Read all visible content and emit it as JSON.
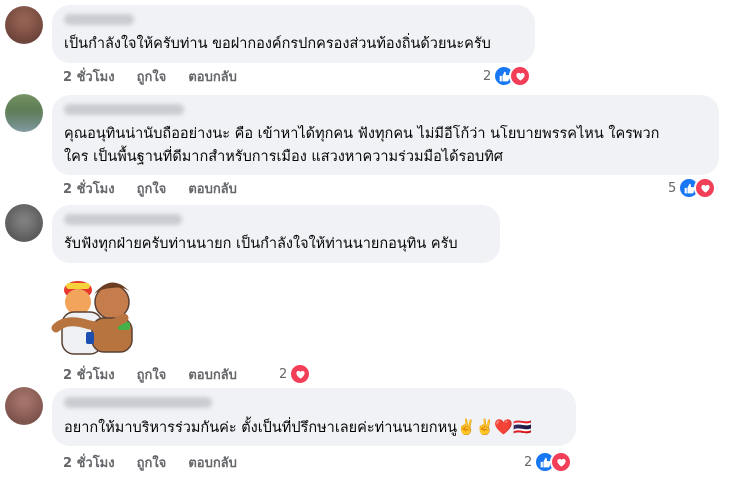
{
  "comments": [
    {
      "text": "เป็นกำลังใจให้ครับท่าน ขอฝากองค์กรปกครองส่วนท้องถิ่นด้วยนะครับ",
      "time": "2 ชั่วโมง",
      "like": "ถูกใจ",
      "reply": "ตอบกลับ",
      "reaction_count": "2",
      "reactions": [
        "like-icon",
        "love-icon"
      ]
    },
    {
      "text_line1": "คุณอนุทินน่านับถืออย่างนะ คือ เข้าหาได้ทุกคน ฟังทุกคน ไม่มีอีโก้ว่า นโยบายพรรคไหน ใครพวก",
      "text_line2": "ใคร เป็นพื้นฐานที่ดีมากสำหรับการเมือง แสวงหาความร่วมมือได้รอบทิศ",
      "time": "2 ชั่วโมง",
      "like": "ถูกใจ",
      "reply": "ตอบกลับ",
      "reaction_count": "5",
      "reactions": [
        "like-icon",
        "love-icon"
      ]
    },
    {
      "text": "รับฟังทุกฝ่ายครับท่านนายก เป็นกำลังใจให้ท่านนายกอนุทิน ครับ",
      "sticker": "hug-sticker",
      "time": "2 ชั่วโมง",
      "like": "ถูกใจ",
      "reply": "ตอบกลับ",
      "reaction_count": "2",
      "reactions": [
        "love-icon"
      ]
    },
    {
      "text": "อยากให้มาบริหารร่วมกันค่ะ ตั้งเป็นที่ปรึกษาเลยค่ะท่านนายกหนู",
      "emojis": "✌️✌️❤️🇹🇭",
      "time": "2 ชั่วโมง",
      "like": "ถูกใจ",
      "reply": "ตอบกลับ",
      "reaction_count": "2",
      "reactions": [
        "like-icon",
        "love-icon"
      ]
    }
  ],
  "colors": {
    "bubble": "#f0f2f5",
    "like_blue": "#1877f2",
    "love_red": "#f33e58",
    "meta_gray": "#65676b"
  }
}
